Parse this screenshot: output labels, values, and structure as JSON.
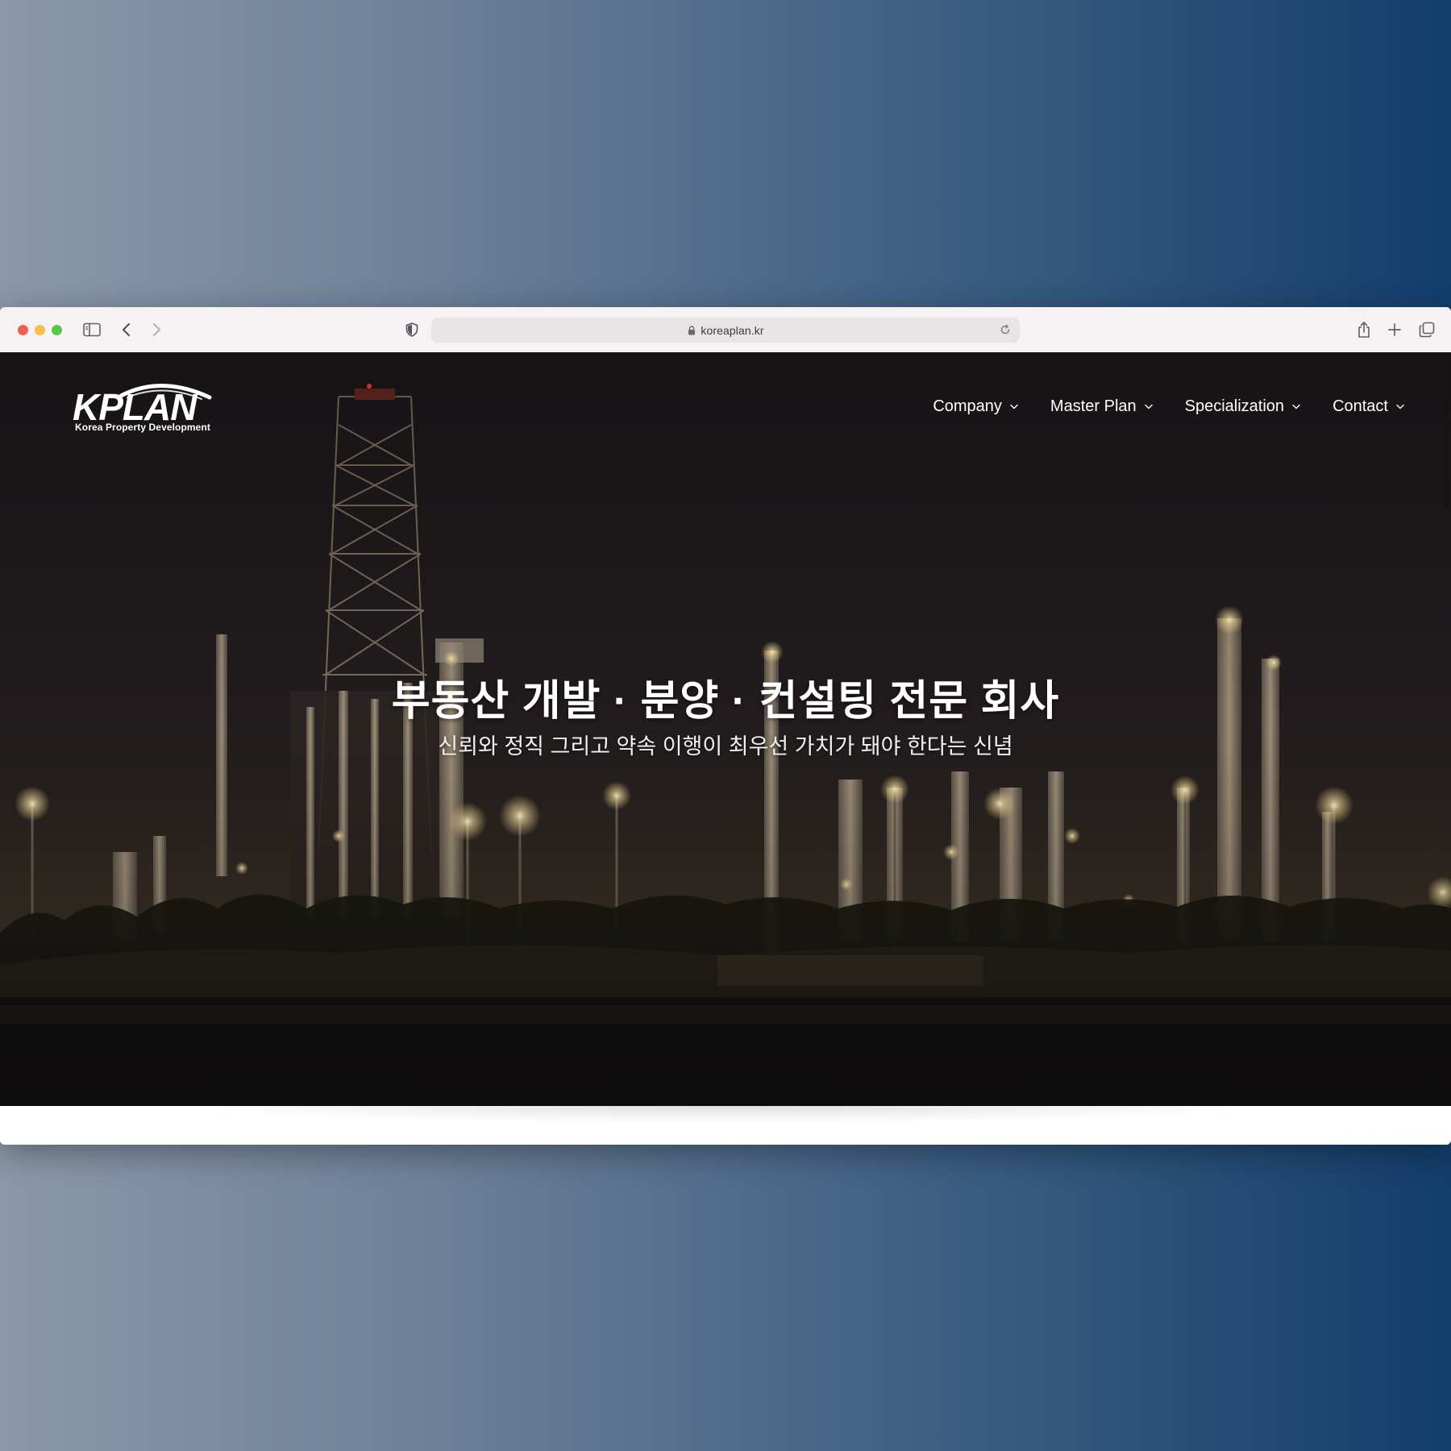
{
  "browser": {
    "url": "koreaplan.kr",
    "colors": {
      "close": "#ec5f59",
      "minimize": "#f5bf4f",
      "zoom": "#5bc749",
      "accent_line": "#d9395a"
    },
    "icons": {
      "sidebar": "sidebar-icon",
      "back": "chevron-left-icon",
      "forward": "chevron-right-icon",
      "privacy": "shield-icon",
      "lock": "lock-icon",
      "reload": "reload-icon",
      "share": "share-icon",
      "new_tab": "plus-icon",
      "tabs": "tabs-overview-icon"
    }
  },
  "site": {
    "logo": {
      "wordmark": "KPLAN",
      "tagline": "Korea Property Development"
    },
    "nav": [
      {
        "label": "Company"
      },
      {
        "label": "Master Plan"
      },
      {
        "label": "Specialization"
      },
      {
        "label": "Contact"
      }
    ],
    "hero": {
      "title": "부동산 개발 · 분양 · 컨설팅 전문 회사",
      "subtitle": "신뢰와 정직 그리고 약속 이행이 최우선 가치가 돼야 한다는 신념"
    }
  }
}
